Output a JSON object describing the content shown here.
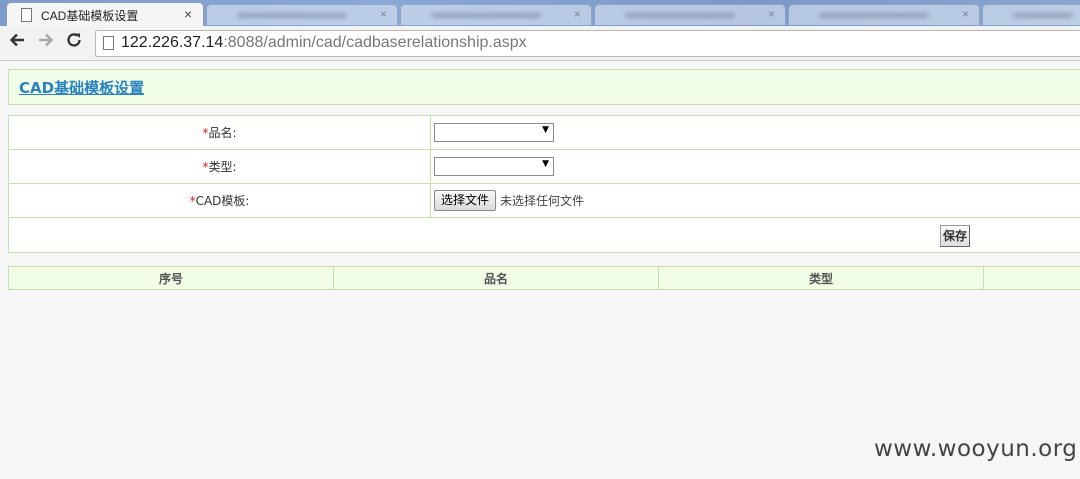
{
  "browser": {
    "tab_title": "CAD基础模板设置",
    "tab_close": "×",
    "inactive_tab_close": "×",
    "url_host": "122.226.37.14",
    "url_rest": ":8088/admin/cad/cadbaserelationship.aspx",
    "back_icon": "arrow-left-icon",
    "forward_icon": "arrow-right-icon",
    "reload_icon": "reload-icon"
  },
  "page": {
    "title": "CAD基础模板设置",
    "form": {
      "required_mark": "*",
      "product_name_label": "品名:",
      "type_label": "类型:",
      "cad_template_label": "CAD模板:",
      "product_name_value": "",
      "type_value": "",
      "file_button_label": "选择文件",
      "file_status": "未选择任何文件",
      "save_label": "保存"
    },
    "list_headers": [
      "序号",
      "品名",
      "类型",
      ""
    ]
  },
  "watermark": "www.wooyun.org",
  "colors": {
    "header_bg": "#f1fde6",
    "border": "#c5e3a8",
    "title_link": "#2a82bf",
    "required": "#e02020"
  }
}
